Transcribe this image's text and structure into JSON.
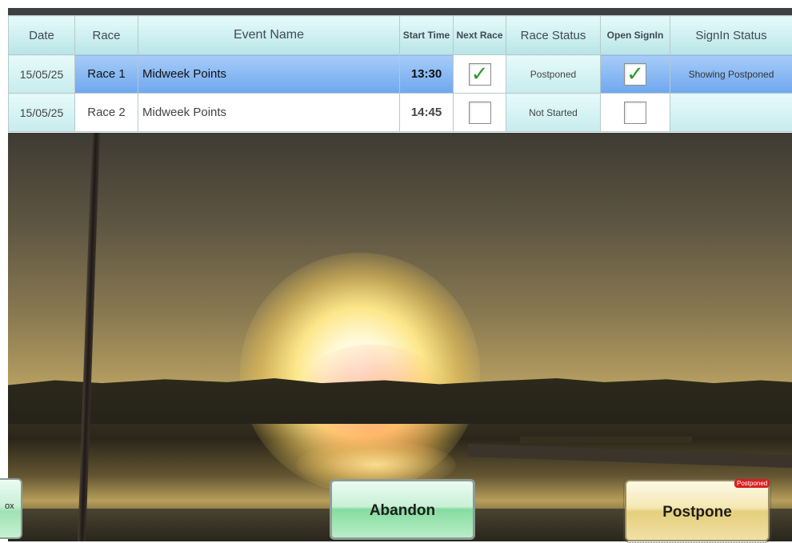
{
  "table": {
    "headers": {
      "date": "Date",
      "race": "Race",
      "event_name": "Event Name",
      "start_time": "Start Time",
      "next_race": "Next Race",
      "race_status": "Race Status",
      "open_signin": "Open SignIn",
      "signin_status": "SignIn Status"
    },
    "rows": [
      {
        "date": "15/05/25",
        "race": "Race 1",
        "event_name": "Midweek Points",
        "start_time": "13:30",
        "next_race_mark": "✓",
        "race_status": "Postponed",
        "open_signin_mark": "✓",
        "signin_status": "Showing Postponed"
      },
      {
        "date": "15/05/25",
        "race": "Race 2",
        "event_name": "Midweek Points",
        "start_time": "14:45",
        "next_race_mark": "",
        "race_status": "Not Started",
        "open_signin_mark": "",
        "signin_status": ""
      }
    ]
  },
  "buttons": {
    "left_partial": "ox",
    "abandon": "Abandon",
    "postpone": "Postpone",
    "postpone_badge": "Postponed"
  },
  "colors": {
    "selected_row": "#6fa7ef",
    "header_teal": "#cdeff0",
    "check_green": "#2a9a2a",
    "badge_red": "#d81f1f"
  }
}
